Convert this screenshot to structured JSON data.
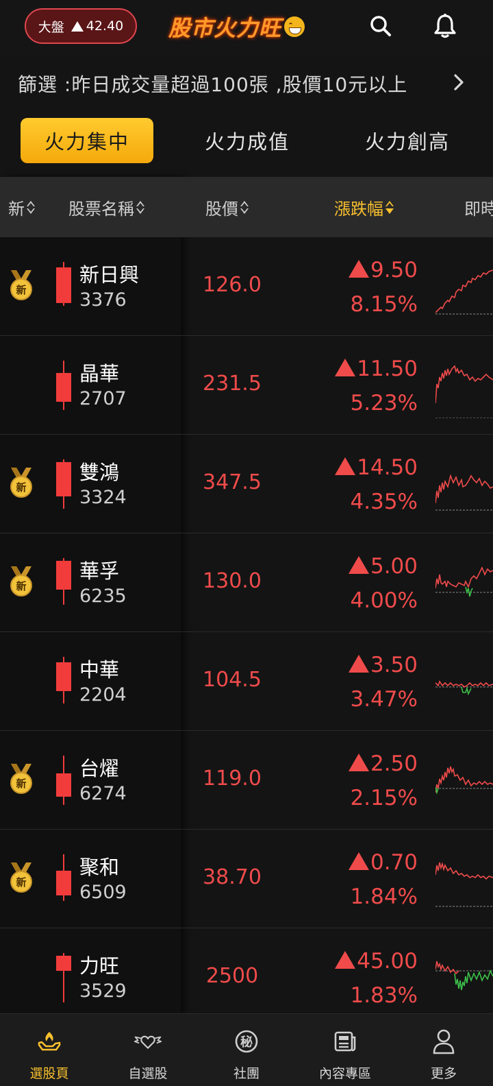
{
  "header": {
    "market_label": "大盤",
    "market_value": "42.40",
    "logo_text": "股市火力旺",
    "search_icon": "search-icon",
    "bell_icon": "bell-icon"
  },
  "filter": {
    "text": "篩選 :昨日成交量超過100張 ,股價10元以上"
  },
  "tabs": [
    {
      "label": "火力集中",
      "active": true
    },
    {
      "label": "火力成值",
      "active": false
    },
    {
      "label": "火力創高",
      "active": false
    }
  ],
  "table": {
    "columns": {
      "new": "新",
      "name": "股票名稱",
      "price": "股價",
      "change": "漲跌幅",
      "realtime": "即時"
    },
    "rows": [
      {
        "new": true,
        "badge": "新",
        "name": "新日興",
        "code": "3376",
        "price": "126.0",
        "change": "9.50",
        "pct": "8.15%"
      },
      {
        "new": false,
        "badge": "",
        "name": "晶華",
        "code": "2707",
        "price": "231.5",
        "change": "11.50",
        "pct": "5.23%"
      },
      {
        "new": true,
        "badge": "新",
        "name": "雙鴻",
        "code": "3324",
        "price": "347.5",
        "change": "14.50",
        "pct": "4.35%"
      },
      {
        "new": true,
        "badge": "新",
        "name": "華孚",
        "code": "6235",
        "price": "130.0",
        "change": "5.00",
        "pct": "4.00%"
      },
      {
        "new": false,
        "badge": "",
        "name": "中華",
        "code": "2204",
        "price": "104.5",
        "change": "3.50",
        "pct": "3.47%"
      },
      {
        "new": true,
        "badge": "新",
        "name": "台燿",
        "code": "6274",
        "price": "119.0",
        "change": "2.50",
        "pct": "2.15%"
      },
      {
        "new": true,
        "badge": "新",
        "name": "聚和",
        "code": "6509",
        "price": "38.70",
        "change": "0.70",
        "pct": "1.84%"
      },
      {
        "new": false,
        "badge": "",
        "name": "力旺",
        "code": "3529",
        "price": "2500",
        "change": "45.00",
        "pct": "1.83%"
      }
    ]
  },
  "bottom_nav": [
    {
      "label": "選股頁",
      "icon": "stock-pick-icon",
      "active": true
    },
    {
      "label": "自選股",
      "icon": "heart-wings-icon",
      "active": false
    },
    {
      "label": "社團",
      "icon": "secret-icon",
      "icon_text": "秘",
      "active": false
    },
    {
      "label": "內容專區",
      "icon": "news-icon",
      "active": false
    },
    {
      "label": "更多",
      "icon": "user-icon",
      "active": false
    }
  ],
  "colors": {
    "up": "#f04b4b",
    "down": "#3cc24a",
    "accent": "#f8c02e",
    "background": "#141414"
  }
}
